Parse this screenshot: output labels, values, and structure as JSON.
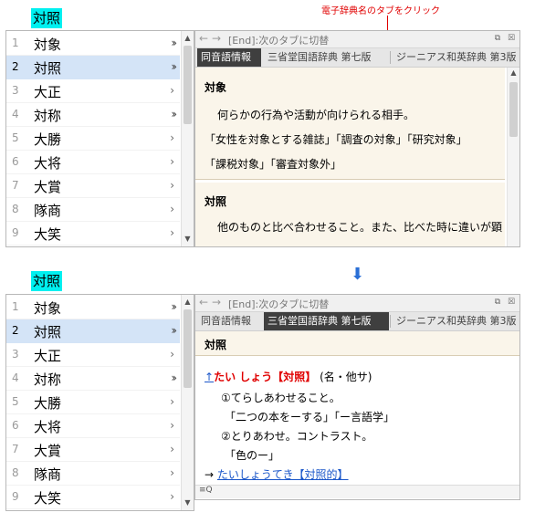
{
  "annotation": {
    "text": "電子辞典名のタブをクリック",
    "color": "#e00000"
  },
  "transition_arrow": {
    "icon": "arrow-down-icon",
    "color": "#2a6fd6"
  },
  "top": {
    "reading": "対照",
    "candidates": [
      {
        "num": "1",
        "word": "対象",
        "arrow": "double"
      },
      {
        "num": "2",
        "word": "対照",
        "arrow": "double",
        "selected": true
      },
      {
        "num": "3",
        "word": "大正",
        "arrow": "single"
      },
      {
        "num": "4",
        "word": "対称",
        "arrow": "double"
      },
      {
        "num": "5",
        "word": "大勝",
        "arrow": "single"
      },
      {
        "num": "6",
        "word": "大将",
        "arrow": "single"
      },
      {
        "num": "7",
        "word": "大賞",
        "arrow": "single"
      },
      {
        "num": "8",
        "word": "隊商",
        "arrow": "single"
      },
      {
        "num": "9",
        "word": "大笑",
        "arrow": "single"
      }
    ],
    "dict": {
      "hint": "[End]:次のタブに切替",
      "tabs": [
        "同音語情報",
        "三省堂国語辞典 第七版",
        "ジーニアス和英辞典 第3版"
      ],
      "active_tab": 0,
      "entries": [
        {
          "title": "対象",
          "lines": [
            "何らかの行為や活動が向けられる相手。",
            "「女性を対象とする雑誌」「調査の対象」「研究対象」",
            "「課税対象」「審査対象外」"
          ]
        },
        {
          "title": "対照",
          "lines": [
            "他のものと比べ合わせること。また、比べた時に違いが顕"
          ]
        }
      ]
    }
  },
  "bottom": {
    "reading": "対照",
    "candidates": [
      {
        "num": "1",
        "word": "対象",
        "arrow": "double"
      },
      {
        "num": "2",
        "word": "対照",
        "arrow": "double",
        "selected": true
      },
      {
        "num": "3",
        "word": "大正",
        "arrow": "single"
      },
      {
        "num": "4",
        "word": "対称",
        "arrow": "double"
      },
      {
        "num": "5",
        "word": "大勝",
        "arrow": "single"
      },
      {
        "num": "6",
        "word": "大将",
        "arrow": "single"
      },
      {
        "num": "7",
        "word": "大賞",
        "arrow": "single"
      },
      {
        "num": "8",
        "word": "隊商",
        "arrow": "single"
      },
      {
        "num": "9",
        "word": "大笑",
        "arrow": "single"
      }
    ],
    "dict": {
      "hint": "[End]:次のタブに切替",
      "tabs": [
        "同音語情報",
        "三省堂国語辞典 第七版",
        "ジーニアス和英辞典 第3版"
      ],
      "active_tab": 1,
      "header": "対照",
      "definition": {
        "back_icon": "↑",
        "headword": "たい しょう【対照】",
        "pos": "(名・他サ)",
        "lines": [
          "①てらしあわせること。",
          "「二つの本をーする」「ー言語学」",
          "②とりあわせ。コントラスト。",
          "「色のー」"
        ],
        "xref_prefix": "→",
        "xref": "たいしょうてき【対照的】"
      },
      "search_icon": "≡Q"
    }
  }
}
